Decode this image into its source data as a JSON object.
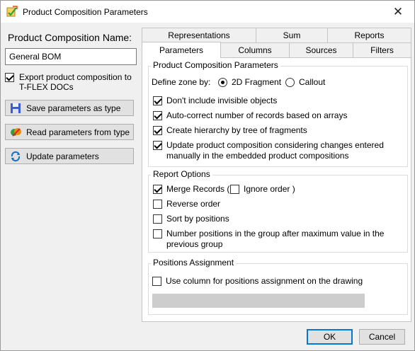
{
  "window": {
    "title": "Product Composition Parameters",
    "close_symbol": "✕"
  },
  "left": {
    "name_label": "Product Composition Name:",
    "name_value": "General BOM",
    "export_label": "Export product composition to T-FLEX DOCs",
    "export_checked": true,
    "buttons": [
      {
        "label": "Save parameters as type",
        "icon": "floppy-disk-icon"
      },
      {
        "label": "Read parameters from type",
        "icon": "read-type-icon"
      },
      {
        "label": "Update parameters",
        "icon": "refresh-icon"
      }
    ]
  },
  "tabs": {
    "row_top": [
      "Representations",
      "Sum",
      "Reports"
    ],
    "row_bottom": [
      "Parameters",
      "Columns",
      "Sources",
      "Filters"
    ],
    "active": "Parameters"
  },
  "composition": {
    "title": "Product Composition Parameters",
    "zone_label": "Define zone by:",
    "zone_options": [
      {
        "label": "2D Fragment",
        "selected": true
      },
      {
        "label": "Callout",
        "selected": false
      }
    ],
    "options": [
      {
        "label": "Don't include invisible objects",
        "checked": true
      },
      {
        "label": "Auto-correct number of records based on arrays",
        "checked": true
      },
      {
        "label": "Create hierarchy by tree of fragments",
        "checked": true
      },
      {
        "label": "Update product composition considering changes entered manually in the embedded product compositions",
        "checked": true
      }
    ]
  },
  "report": {
    "title": "Report Options",
    "merge_label": "Merge Records (",
    "ignore_label": "Ignore order )",
    "merge_checked": true,
    "ignore_checked": false,
    "options": [
      {
        "label": "Reverse order",
        "checked": false
      },
      {
        "label": "Sort by positions",
        "checked": false
      },
      {
        "label": "Number positions in the group after maximum value in the previous group",
        "checked": false
      }
    ]
  },
  "positions": {
    "title": "Positions Assignment",
    "use_column_label": "Use column for positions assignment on the drawing",
    "use_column_checked": false
  },
  "footer": {
    "ok_label": "OK",
    "cancel_label": "Cancel"
  }
}
